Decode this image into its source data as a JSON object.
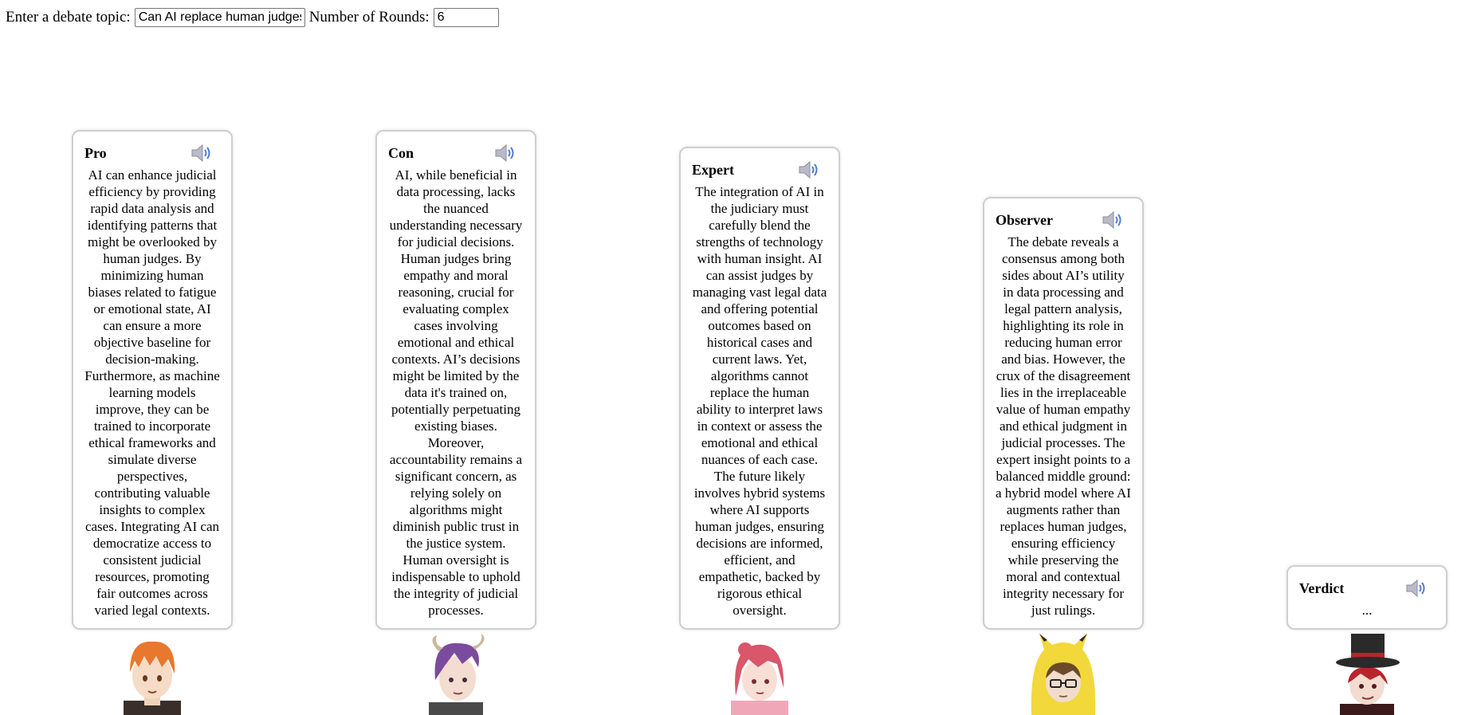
{
  "controls": {
    "topic_label": "Enter a debate topic:",
    "topic_value": "Can AI replace human judges",
    "rounds_label": "Number of Rounds:",
    "rounds_value": "6"
  },
  "speakers": [
    {
      "title": "Pro",
      "icon": "speaker-icon",
      "text": "AI can enhance judicial efficiency by providing rapid data analysis and identifying patterns that might be overlooked by human judges. By minimizing human biases related to fatigue or emotional state, AI can ensure a more objective baseline for decision-making. Furthermore, as machine learning models improve, they can be trained to incorporate ethical frameworks and simulate diverse perspectives, contributing valuable insights to complex cases. Integrating AI can democratize access to consistent judicial resources, promoting fair outcomes across varied legal contexts."
    },
    {
      "title": "Con",
      "icon": "speaker-icon",
      "text": "AI, while beneficial in data processing, lacks the nuanced understanding necessary for judicial decisions. Human judges bring empathy and moral reasoning, crucial for evaluating complex cases involving emotional and ethical contexts. AI’s decisions might be limited by the data it's trained on, potentially perpetuating existing biases. Moreover, accountability remains a significant concern, as relying solely on algorithms might diminish public trust in the justice system. Human oversight is indispensable to uphold the integrity of judicial processes."
    },
    {
      "title": "Expert",
      "icon": "speaker-icon",
      "text": "The integration of AI in the judiciary must carefully blend the strengths of technology with human insight. AI can assist judges by managing vast legal data and offering potential outcomes based on historical cases and current laws. Yet, algorithms cannot replace the human ability to interpret laws in context or assess the emotional and ethical nuances of each case. The future likely involves hybrid systems where AI supports human judges, ensuring decisions are informed, efficient, and empathetic, backed by rigorous ethical oversight."
    },
    {
      "title": "Observer",
      "icon": "speaker-icon",
      "text": "The debate reveals a consensus among both sides about AI’s utility in data processing and legal pattern analysis, highlighting its role in reducing human error and bias. However, the crux of the disagreement lies in the irreplaceable value of human empathy and ethical judgment in judicial processes. The expert insight points to a balanced middle ground: a hybrid model where AI augments rather than replaces human judges, ensuring efficiency while preserving the moral and contextual integrity necessary for just rulings."
    },
    {
      "title": "Verdict",
      "icon": "speaker-icon",
      "text": "..."
    }
  ],
  "colors": {
    "bubble_border": "#cfcfcf",
    "pro_hair": "#e8782e",
    "con_hair": "#7a4b9e",
    "expert_hair": "#d9566b",
    "observer_hood": "#f2d83a",
    "verdict_hat": "#2a2a2a"
  }
}
